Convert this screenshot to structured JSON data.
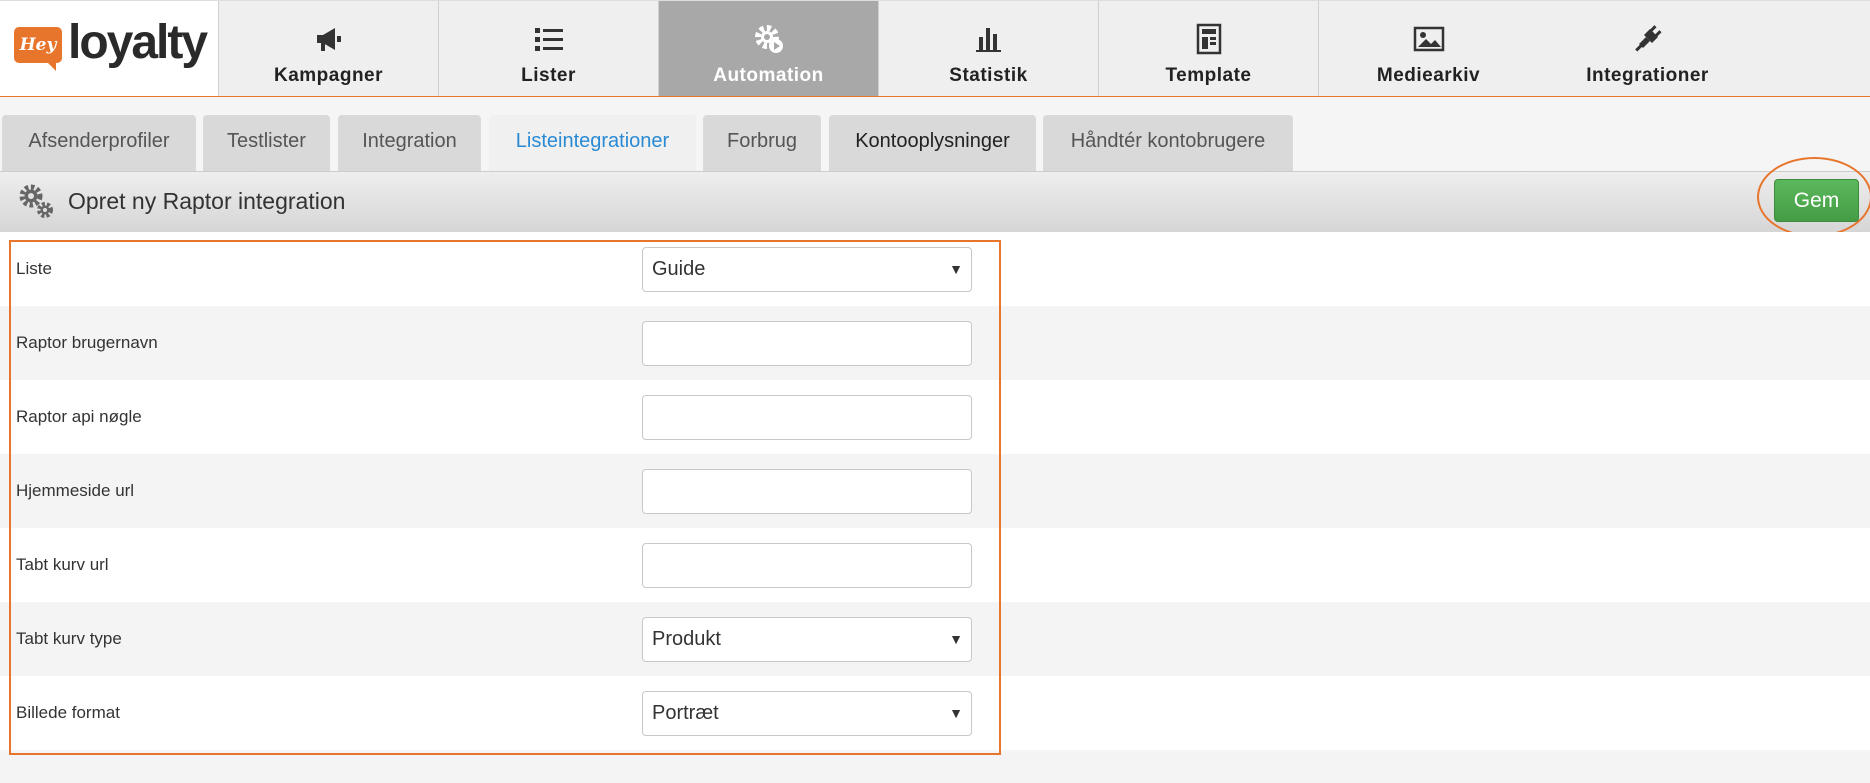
{
  "app": {
    "logo_badge": "Hey",
    "logo_word": "loyalty"
  },
  "nav": [
    {
      "label": "Kampagner",
      "icon": "megaphone-icon"
    },
    {
      "label": "Lister",
      "icon": "list-icon"
    },
    {
      "label": "Automation",
      "icon": "gear-play-icon",
      "active": true
    },
    {
      "label": "Statistik",
      "icon": "bar-chart-icon"
    },
    {
      "label": "Template",
      "icon": "template-icon"
    },
    {
      "label": "Mediearkiv",
      "icon": "image-icon"
    },
    {
      "label": "Integrationer",
      "icon": "plug-icon"
    }
  ],
  "tabs": [
    {
      "label": "Afsenderprofiler"
    },
    {
      "label": "Testlister"
    },
    {
      "label": "Integration"
    },
    {
      "label": "Listeintegrationer",
      "active": true
    },
    {
      "label": "Forbrug"
    },
    {
      "label": "Kontooplysninger"
    },
    {
      "label": "Håndtér kontobrugere"
    }
  ],
  "header": {
    "title": "Opret ny Raptor integration",
    "save_label": "Gem"
  },
  "form": {
    "rows": [
      {
        "label": "Liste",
        "type": "select",
        "value": "Guide"
      },
      {
        "label": "Raptor brugernavn",
        "type": "text",
        "value": ""
      },
      {
        "label": "Raptor api nøgle",
        "type": "text",
        "value": ""
      },
      {
        "label": "Hjemmeside url",
        "type": "text",
        "value": ""
      },
      {
        "label": "Tabt kurv url",
        "type": "text",
        "value": ""
      },
      {
        "label": "Tabt kurv type",
        "type": "select",
        "value": "Produkt"
      },
      {
        "label": "Billede format",
        "type": "select",
        "value": "Portræt"
      }
    ]
  },
  "colors": {
    "accent": "#e8752c",
    "active_tab": "#2a8ad4",
    "save_button": "#5cb85c",
    "active_nav": "#a8a8a8"
  }
}
